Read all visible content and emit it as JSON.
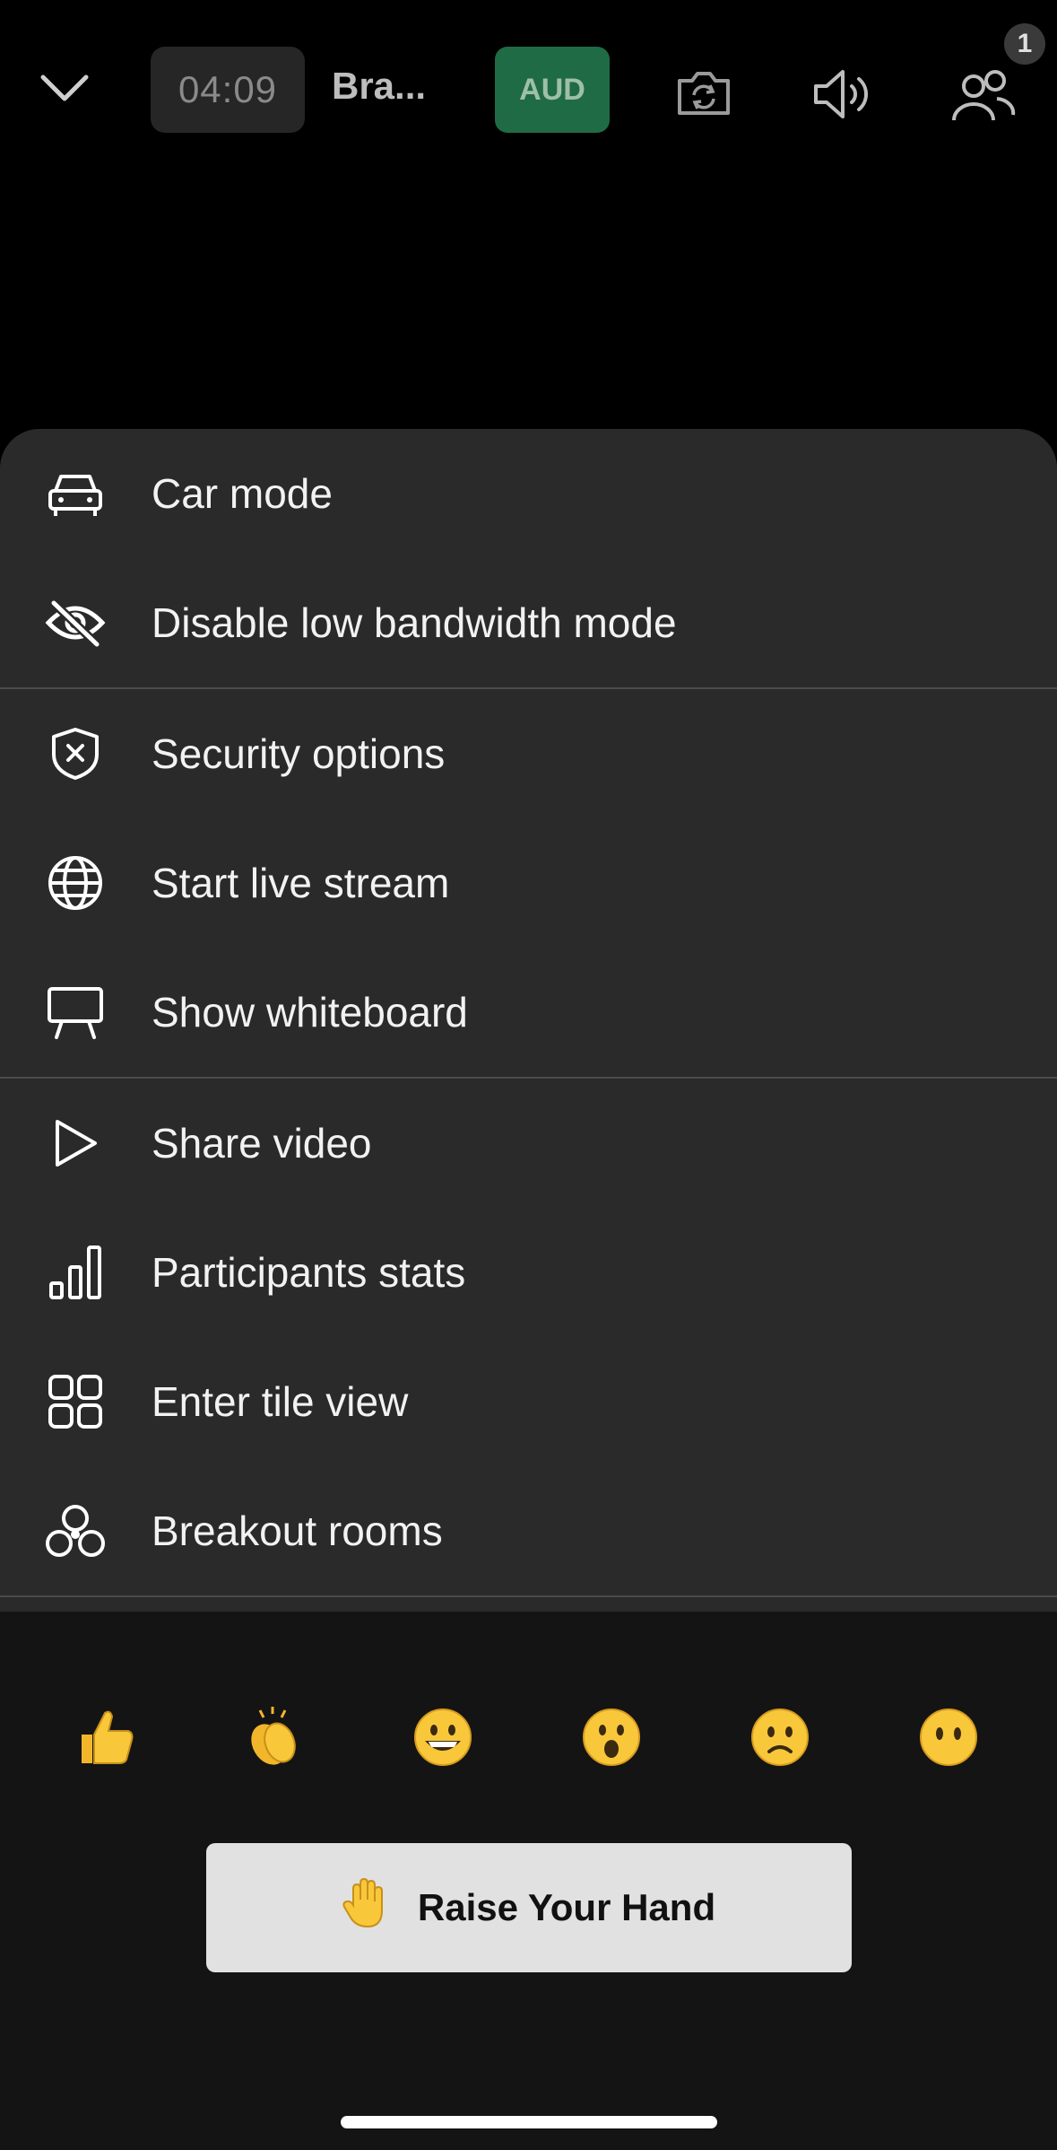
{
  "topbar": {
    "timer": "04:09",
    "title": "Bra...",
    "aud_label": "AUD",
    "participants_badge": "1",
    "icons": [
      "chevron-down-icon",
      "camera-switch-icon",
      "speaker-icon",
      "participants-icon"
    ]
  },
  "menu": {
    "items": [
      {
        "label": "Car mode",
        "icon": "car-icon"
      },
      {
        "label": "Disable low bandwidth mode",
        "icon": "eye-off-icon"
      },
      {
        "label": "Security options",
        "icon": "shield-x-icon"
      },
      {
        "label": "Start live stream",
        "icon": "globe-icon"
      },
      {
        "label": "Show whiteboard",
        "icon": "whiteboard-icon"
      },
      {
        "label": "Share video",
        "icon": "play-icon"
      },
      {
        "label": "Participants stats",
        "icon": "bar-chart-icon"
      },
      {
        "label": "Enter tile view",
        "icon": "tile-grid-icon"
      },
      {
        "label": "Breakout rooms",
        "icon": "breakout-rooms-icon"
      }
    ]
  },
  "reactions": [
    {
      "name": "thumbs-up",
      "glyph": "👍"
    },
    {
      "name": "clapping",
      "glyph": "👏"
    },
    {
      "name": "grinning",
      "glyph": "😀"
    },
    {
      "name": "surprised",
      "glyph": "😮"
    },
    {
      "name": "slightly-frowning",
      "glyph": "🙁"
    },
    {
      "name": "no-mouth",
      "glyph": "😶"
    }
  ],
  "raise_hand": {
    "label": "Raise Your Hand",
    "glyph": "✋"
  },
  "colors": {
    "accent_aud": "#1f6b45",
    "sheet_bg": "#2a2a2a",
    "reaction_bg": "#141414",
    "button_bg": "#e1e1e1"
  }
}
